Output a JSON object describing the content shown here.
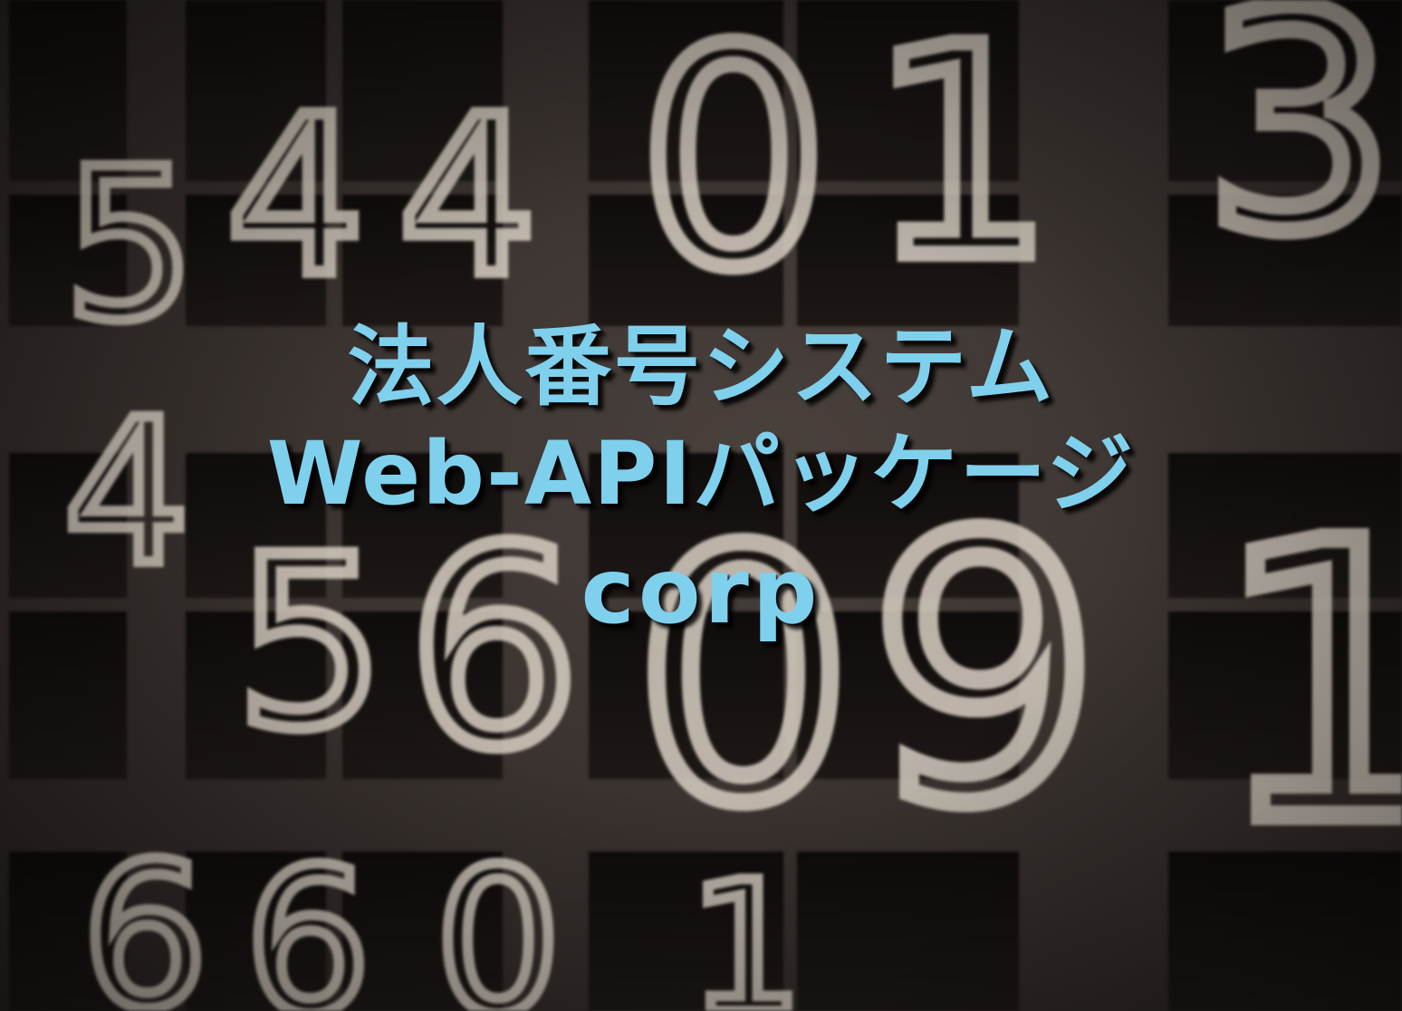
{
  "title": {
    "line1": "法人番号システム",
    "line2": "Web-APIパッケージ",
    "line3": "corp"
  },
  "colors": {
    "title_text": "#7fd0ec",
    "background": "#3a3330",
    "cell_dark": "#141010",
    "digit_light": "#e9e1d6"
  }
}
